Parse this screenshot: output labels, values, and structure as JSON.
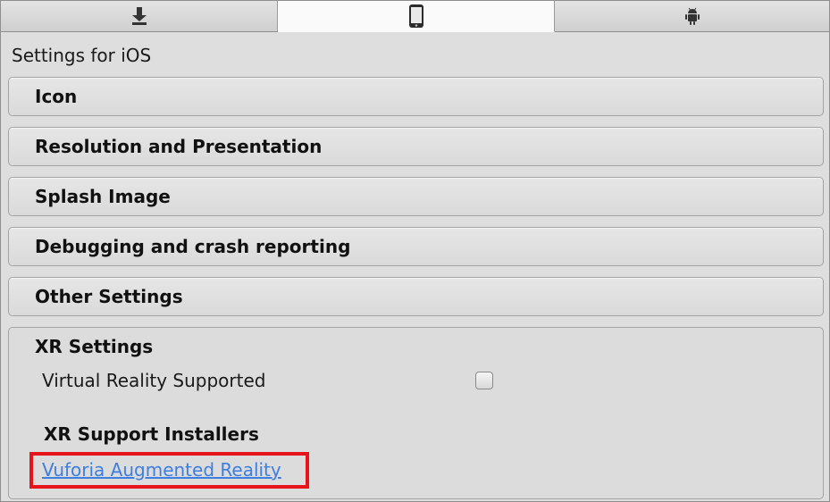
{
  "tabs": [
    {
      "icon": "download-icon",
      "selected": false
    },
    {
      "icon": "phone-icon",
      "selected": true
    },
    {
      "icon": "android-icon",
      "selected": false
    }
  ],
  "settings_title": "Settings for iOS",
  "sections": [
    {
      "label": "Icon"
    },
    {
      "label": "Resolution and Presentation"
    },
    {
      "label": "Splash Image"
    },
    {
      "label": "Debugging and crash reporting"
    },
    {
      "label": "Other Settings"
    }
  ],
  "xr": {
    "label": "XR Settings",
    "vr_supported_label": "Virtual Reality Supported",
    "vr_supported_checked": false,
    "installers_label": "XR Support Installers",
    "vuforia_link": "Vuforia Augmented Reality"
  },
  "colors": {
    "link": "#3d7ee0",
    "highlight": "#e8141c"
  }
}
